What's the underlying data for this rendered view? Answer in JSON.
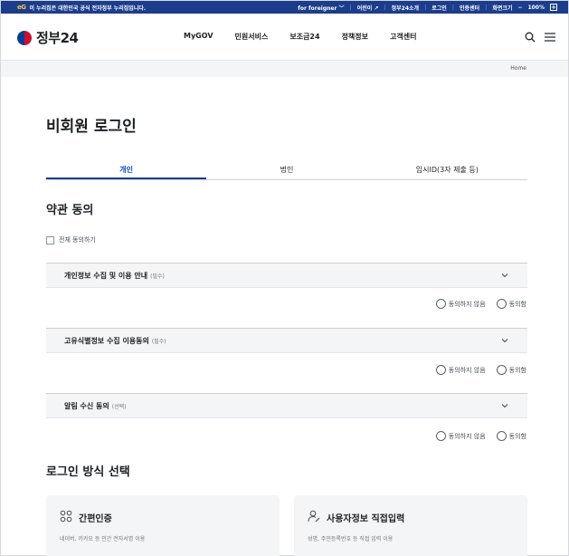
{
  "topbar": {
    "badge": "eG",
    "notice": "이 누리집은 대한민국 공식 전자정부 누리집입니다.",
    "links": [
      "for foreigner",
      "어린이",
      "정부24소개",
      "로그인",
      "인증센터",
      "화면크기",
      "100%"
    ]
  },
  "header": {
    "logo_text": "정부24",
    "nav": [
      "MyGOV",
      "민원서비스",
      "보조금24",
      "정책정보",
      "고객센터"
    ]
  },
  "breadcrumb": {
    "home": "Home"
  },
  "page": {
    "title": "비회원 로그인"
  },
  "tabs": [
    "개인",
    "법인",
    "임시ID(3자 제출 등)"
  ],
  "terms": {
    "title": "약관 동의",
    "agree_all": "전체 동의하기",
    "items": [
      {
        "label": "개인정보 수집 및 이용 안내",
        "tag": "(필수)"
      },
      {
        "label": "고유식별정보 수집 이용동의",
        "tag": "(필수)"
      },
      {
        "label": "알림 수신 동의",
        "tag": "(선택)"
      }
    ],
    "disagree": "동의하지 않음",
    "agree": "동의함"
  },
  "login_method": {
    "title": "로그인 방식 선택",
    "cards": [
      {
        "title": "간편인증",
        "desc": "네이버, 카카오 등 민간 전자서명 이용"
      },
      {
        "title": "사용자정보 직접입력",
        "desc": "성명, 주민등록번호 등 직접 입력 이용"
      }
    ]
  },
  "colors": {
    "navy": "#1c3d8c",
    "blue": "#0b50d0",
    "gray_bg": "#f4f5f6"
  }
}
